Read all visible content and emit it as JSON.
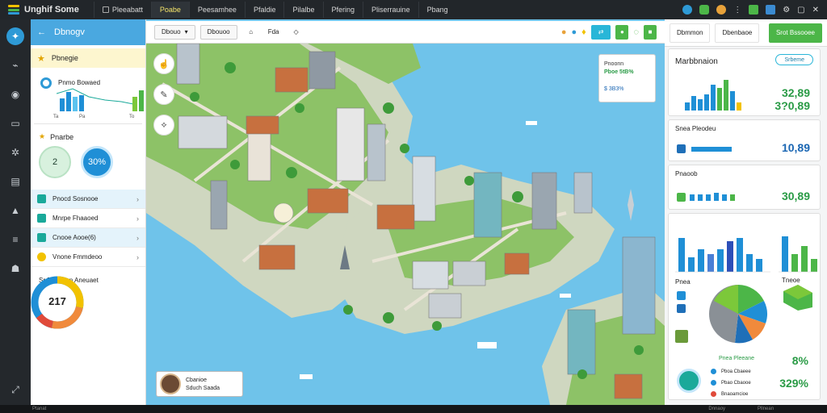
{
  "app": {
    "title": "Unghif Some",
    "brand_colors": {
      "accent": "#2e9ad6",
      "green": "#4cb648",
      "yellow": "#f2c200"
    }
  },
  "top_tabs": [
    {
      "label": "Pleeabatt"
    },
    {
      "label": "Poabe"
    },
    {
      "label": "Peesamhee"
    },
    {
      "label": "Pfaldie"
    },
    {
      "label": "Pilalbe"
    },
    {
      "label": "Pfering"
    },
    {
      "label": "Pliserrauine"
    },
    {
      "label": "Pbang"
    }
  ],
  "sidebar": {
    "header": "Dbnogv",
    "highlight": "Pbnegie",
    "chart_card": {
      "label": "Pnmo Bowaed",
      "ticks": [
        "Ta",
        "Pa",
        "To"
      ]
    },
    "section": "Pnarbe",
    "circles": [
      {
        "value": "2"
      },
      {
        "value": "30%"
      }
    ],
    "items": [
      {
        "label": "Pnocd Sosnooe"
      },
      {
        "label": "Mnrpe Fhaaoed"
      },
      {
        "label": "Cnooe Aooe(6)"
      },
      {
        "label": "Vnone Fmmdeoo"
      }
    ],
    "donut_label": "Sr Pbaoean Aneuaet",
    "donut_value": "217"
  },
  "map_toolbar": {
    "dropdown": "Dbouo",
    "button": "Dbouoo",
    "filter_label": "Fda"
  },
  "map_card": {
    "line1": "Pnoonn",
    "line2": "Pboe 5tB%",
    "line3": "$ 3B3%"
  },
  "profile": {
    "name": "Cbanioe",
    "sub": "Sduch Saada"
  },
  "right_panel": {
    "tabs": [
      "Dbmmon",
      "Dbenbaoe",
      "Srot Bssooee"
    ],
    "card1": {
      "title": "Marbbnaion",
      "pill": "Srbeme",
      "value1": "32,89",
      "value2": "3?0,89"
    },
    "card2": {
      "title": "Snea Pleodeu",
      "value": "10,89"
    },
    "card3": {
      "title": "Pnaoob",
      "value": "30,89"
    },
    "card4": {
      "legend_title": "Pnea",
      "pie_label": "Pnea Pleeane"
    },
    "legend": [
      "Pboa Cbaeee",
      "Pbao Cbaooe",
      "Bnaoamcioe"
    ],
    "stats": [
      "8%",
      "329%"
    ],
    "stats_label": "Tneoe"
  },
  "status": [
    "Ptanat",
    "Dnnaoy",
    "Pllnean"
  ]
}
